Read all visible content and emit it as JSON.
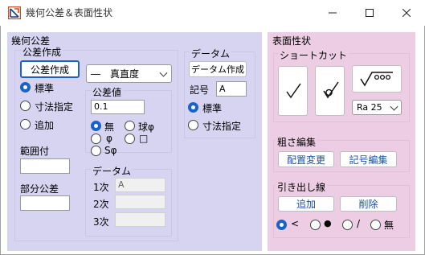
{
  "window": {
    "title": "幾何公差＆表面性状"
  },
  "geometric": {
    "section_title": "幾何公差",
    "create_group_title": "公差作成",
    "create_button": "公差作成",
    "symbol_select": "―　真直度",
    "radio_standard": "標準",
    "radio_dimension": "寸法指定",
    "radio_append": "追加",
    "tolerance_label": "公差値",
    "tolerance_value": "0.1",
    "shape_none": "無",
    "shape_sphere": "球φ",
    "shape_phi": "φ",
    "shape_square": "□",
    "shape_sphi": "Sφ",
    "range_label": "範囲付",
    "partial_label": "部分公差",
    "datum_group_title": "データム",
    "datum_1_label": "1次",
    "datum_1_value": "A",
    "datum_2_label": "2次",
    "datum_3_label": "3次"
  },
  "datum": {
    "section_title": "データム",
    "create_button": "データム作成",
    "symbol_label": "記号",
    "symbol_value": "A",
    "radio_standard": "標準",
    "radio_dimension": "寸法指定"
  },
  "surface": {
    "section_title": "表面性状",
    "shortcut_title": "ショートカット",
    "ra_value": "Ra 25",
    "rough_edit_title": "粗さ編集",
    "layout_change_button": "配置変更",
    "symbol_edit_button": "記号編集",
    "leader_title": "引き出し線",
    "add_button": "追加",
    "delete_button": "削除",
    "leader_arrow": "<",
    "leader_dot": "●",
    "leader_slash": "/",
    "leader_none": "無"
  }
}
